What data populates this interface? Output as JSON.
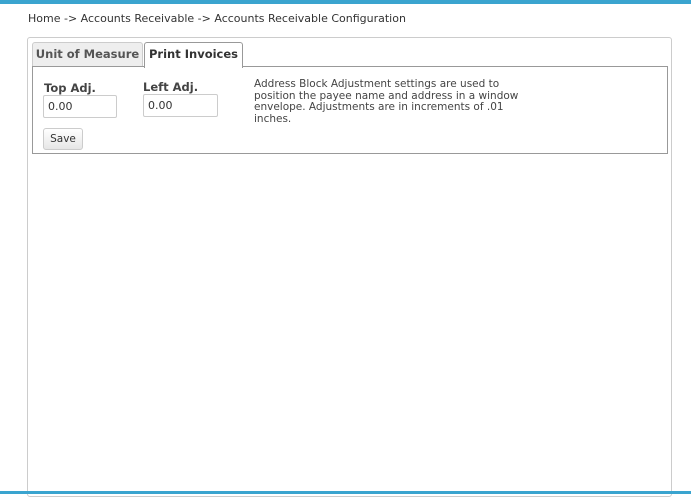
{
  "breadcrumb": {
    "home": "Home",
    "separator": " -> ",
    "accounts_receivable": "Accounts Receivable",
    "current": "Accounts Receivable Configuration"
  },
  "tabs": [
    {
      "label": "Unit of Measure",
      "active": false
    },
    {
      "label": "Print Invoices",
      "active": true
    }
  ],
  "form": {
    "top_adj": {
      "label": "Top Adj.",
      "value": "0.00"
    },
    "left_adj": {
      "label": "Left Adj.",
      "value": "0.00"
    },
    "help_text": "Address Block Adjustment settings are used to position the payee name and address in a window envelope. Adjustments are in increments of .01 inches.",
    "save_label": "Save"
  },
  "colors": {
    "accent_bar": "#3aa4cf"
  }
}
